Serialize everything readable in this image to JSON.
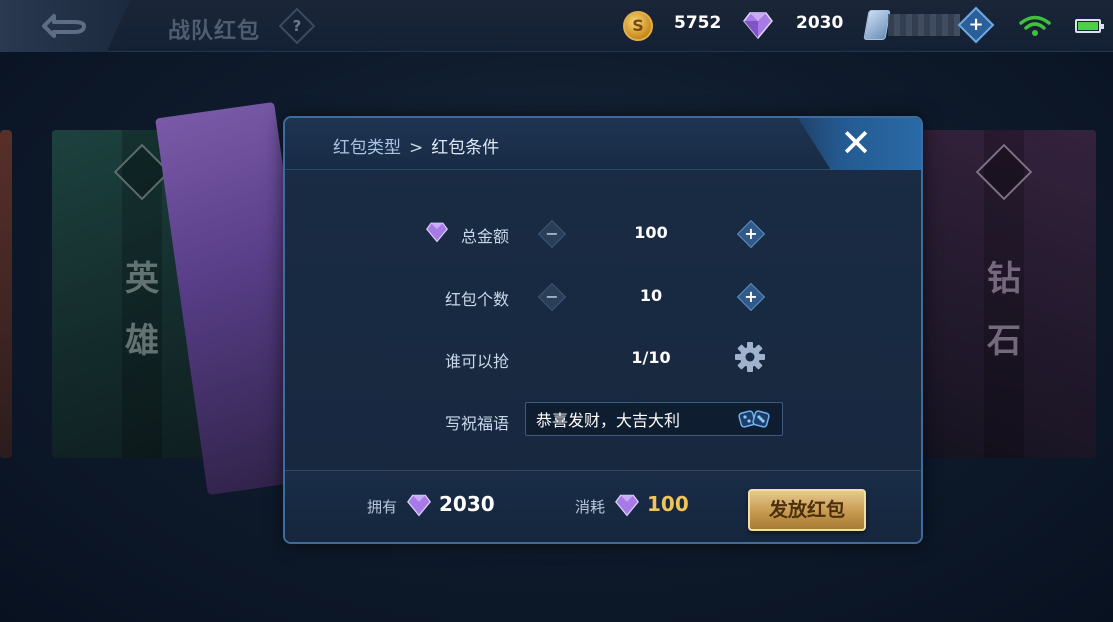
{
  "header": {
    "title": "战队红包",
    "help_label": "?",
    "coin_symbol": "S",
    "coins": "5752",
    "gems": "2030",
    "add_label": "+"
  },
  "cards": {
    "left_text": [
      "英",
      "雄"
    ],
    "right_text": [
      "钻",
      "石"
    ]
  },
  "modal": {
    "breadcrumb_prev": "红包类型",
    "breadcrumb_sep": ">",
    "breadcrumb_current": "红包条件",
    "close_label": "✕",
    "total_label": "总金额",
    "total_value": "100",
    "count_label": "红包个数",
    "count_value": "10",
    "who_label": "谁可以抢",
    "who_value": "1/10",
    "blessing_label": "写祝福语",
    "blessing_value": "恭喜发财，大吉大利",
    "minus_label": "−",
    "plus_label": "+",
    "own_label": "拥有",
    "own_value": "2030",
    "cost_label": "消耗",
    "cost_value": "100",
    "send_label": "发放红包"
  },
  "colors": {
    "accent_blue": "#3f6c9e",
    "gold": "#f0c45a",
    "gem_purple": "#b58cf0",
    "wifi_green": "#3ec23a"
  }
}
